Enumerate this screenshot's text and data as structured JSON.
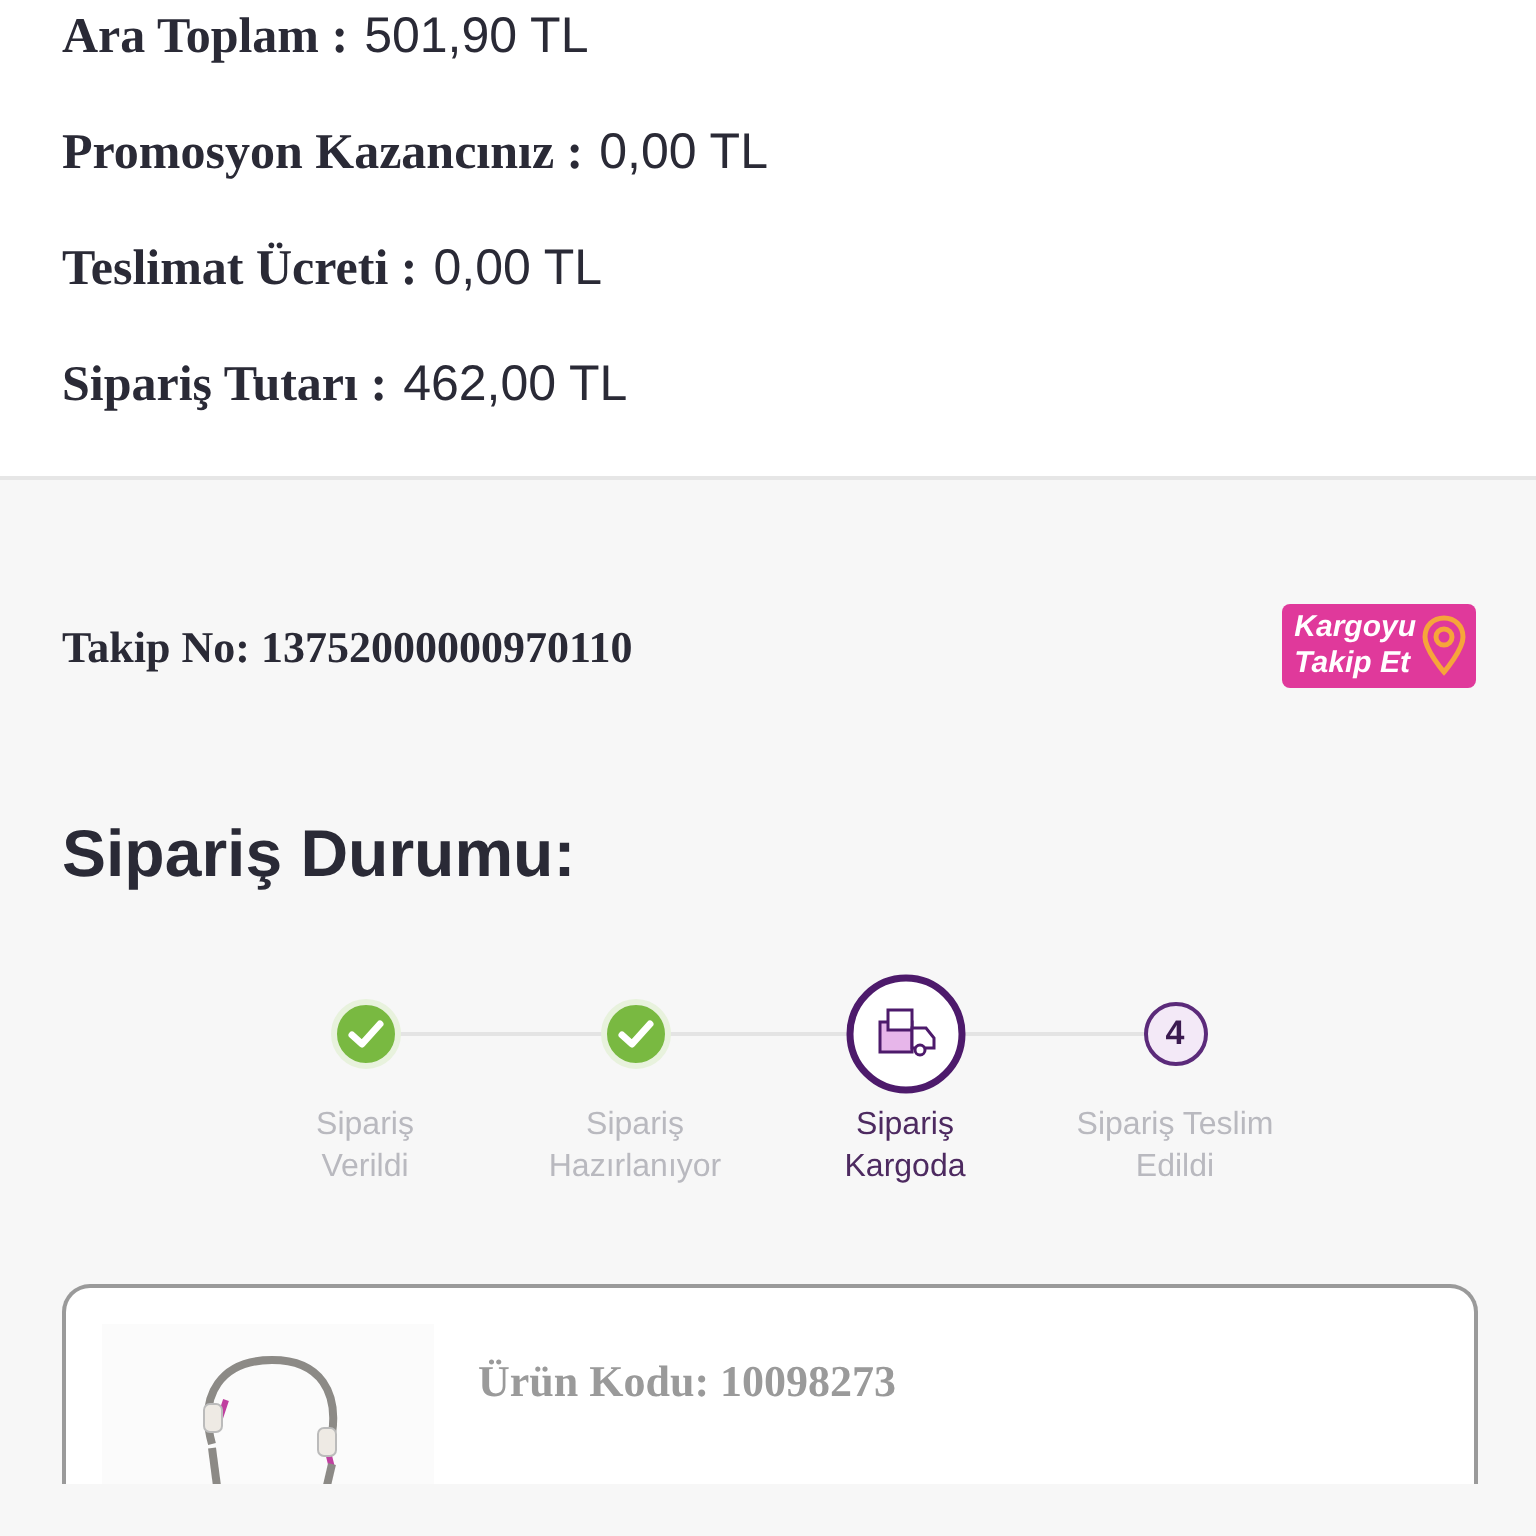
{
  "summary": [
    {
      "label": "Ara Toplam :",
      "value": "501,90 TL"
    },
    {
      "label": "Promosyon Kazancınız :",
      "value": "0,00 TL"
    },
    {
      "label": "Teslimat Ücreti :",
      "value": "0,00 TL"
    },
    {
      "label": "Sipariş Tutarı :",
      "value": "462,00 TL"
    }
  ],
  "tracking": {
    "label": "Takip No: 13752000000970110",
    "button": [
      "Kargoyu",
      "Takip Et"
    ]
  },
  "status_title": "Sipariş Durumu:",
  "steps": [
    {
      "kind": "done",
      "label": [
        "Sipariş",
        "Verildi"
      ]
    },
    {
      "kind": "done",
      "label": [
        "Sipariş",
        "Hazırlanıyor"
      ]
    },
    {
      "kind": "current",
      "label": [
        "Sipariş",
        "Kargoda"
      ]
    },
    {
      "kind": "pending",
      "number": "4",
      "label": [
        "Sipariş Teslim",
        "Edildi"
      ]
    }
  ],
  "product": {
    "code": "Ürün Kodu: 10098273"
  }
}
